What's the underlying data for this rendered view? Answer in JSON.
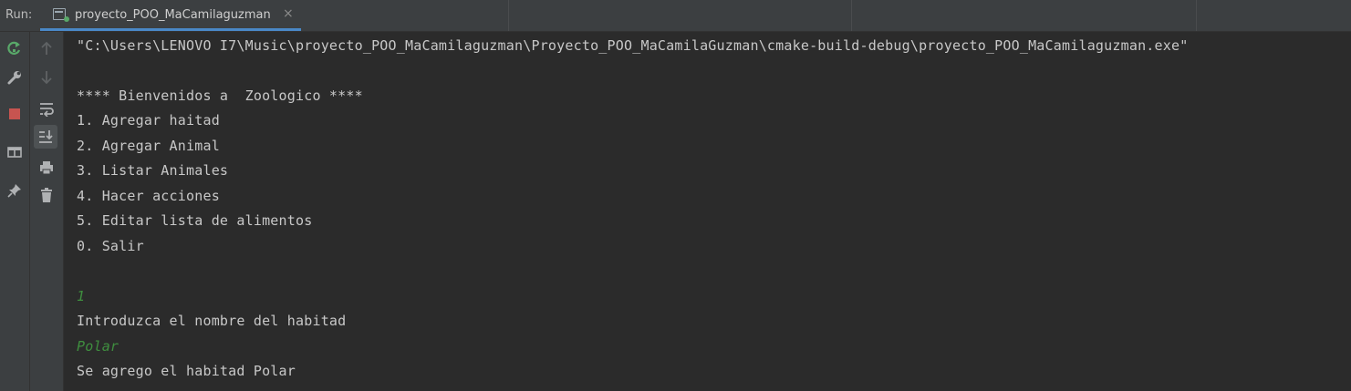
{
  "run_label": "Run:",
  "tab": {
    "label": "proyecto_POO_MaCamilaguzman",
    "close": "×"
  },
  "toolbar_left": [
    {
      "name": "rerun-icon"
    },
    {
      "name": "wrench-icon"
    },
    {
      "name": "stop-icon"
    },
    {
      "name": "layout-icon"
    },
    {
      "name": "pin-icon"
    }
  ],
  "toolbar_right": [
    {
      "name": "up-arrow-icon"
    },
    {
      "name": "down-arrow-icon"
    },
    {
      "name": "soft-wrap-icon"
    },
    {
      "name": "scroll-to-end-icon"
    },
    {
      "name": "print-icon"
    },
    {
      "name": "trash-icon"
    }
  ],
  "console": {
    "lines": [
      {
        "text": "\"C:\\Users\\LENOVO I7\\Music\\proyecto_POO_MaCamilaguzman\\Proyecto_POO_MaCamilaGuzman\\cmake-build-debug\\proyecto_POO_MaCamilaguzman.exe\"",
        "type": "output"
      },
      {
        "text": "",
        "type": "output"
      },
      {
        "text": "**** Bienvenidos a  Zoologico ****",
        "type": "output"
      },
      {
        "text": "1. Agregar haitad",
        "type": "output"
      },
      {
        "text": "2. Agregar Animal",
        "type": "output"
      },
      {
        "text": "3. Listar Animales",
        "type": "output"
      },
      {
        "text": "4. Hacer acciones",
        "type": "output"
      },
      {
        "text": "5. Editar lista de alimentos",
        "type": "output"
      },
      {
        "text": "0. Salir",
        "type": "output"
      },
      {
        "text": "",
        "type": "output"
      },
      {
        "text": "1",
        "type": "input"
      },
      {
        "text": "Introduzca el nombre del habitad",
        "type": "output"
      },
      {
        "text": "Polar",
        "type": "input"
      },
      {
        "text": "Se agrego el habitad Polar",
        "type": "output"
      }
    ]
  },
  "colors": {
    "background": "#2b2b2b",
    "toolbar": "#3c3f41",
    "output_text": "#c8c8c8",
    "input_text": "#3f8f3f",
    "tab_underline": "#4a88c7"
  }
}
